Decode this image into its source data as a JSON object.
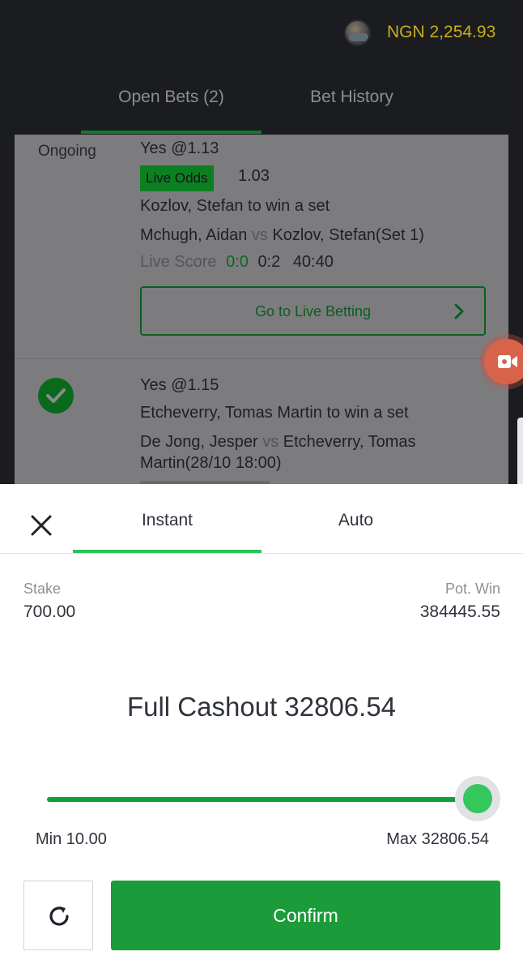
{
  "header": {
    "balance": "NGN 2,254.93",
    "tabs": [
      {
        "label": "Open Bets (2)",
        "active": true
      },
      {
        "label": "Bet History",
        "active": false
      }
    ]
  },
  "bets": [
    {
      "status": "Ongoing",
      "selection": "Yes",
      "odds": "@1.13",
      "live_odds_label": "Live Odds",
      "live_odds_value": "1.03",
      "market": "Kozlov, Stefan to win a set",
      "home": "Mchugh, Aidan",
      "vs": "vs",
      "away": "Kozlov, Stefan(Set 1)",
      "live_score_label": "Live Score",
      "score_sets": "0:0",
      "score_games": "0:2",
      "score_points": "40:40",
      "goto_label": "Go to Live Betting"
    },
    {
      "status_icon": "check-circle-icon",
      "selection": "Yes",
      "odds": "@1.15",
      "market": "Etcheverry, Tomas Martin to win a set",
      "home": "De Jong, Jesper",
      "vs": "vs",
      "away_line1": "Etcheverry, Tomas",
      "away_line2": "Martin(28/10 18:00)"
    }
  ],
  "cashout": {
    "tabs": [
      {
        "label": "Instant",
        "active": true
      },
      {
        "label": "Auto",
        "active": false
      }
    ],
    "stake_label": "Stake",
    "stake": "700.00",
    "pot_win_label": "Pot. Win",
    "pot_win": "384445.55",
    "full_cashout": "Full Cashout 32806.54",
    "slider": {
      "min_label": "Min 10.00",
      "max_label": "Max 32806.54",
      "fraction": 1.0
    },
    "confirm_label": "Confirm"
  },
  "colors": {
    "brand_green": "#1b9b39",
    "knob_green": "#34c75c",
    "balance_gold": "#c9ad1e"
  }
}
